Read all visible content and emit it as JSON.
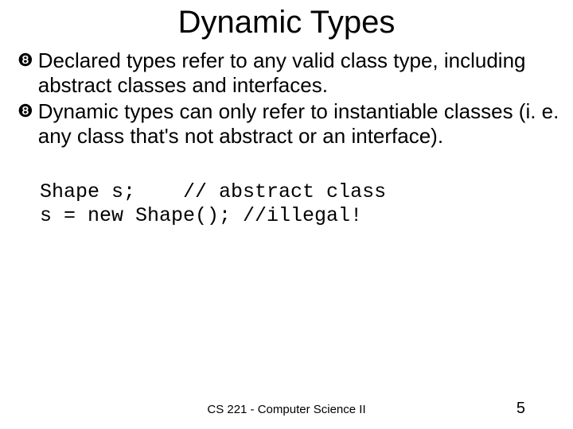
{
  "title": "Dynamic Types",
  "bullets": [
    "Declared types refer to any valid class type, including abstract classes and interfaces.",
    "Dynamic types can only refer to instantiable classes (i. e. any class that's not abstract or an interface)."
  ],
  "code": {
    "line1": "Shape s;    // abstract class",
    "line2": "s = new Shape(); //illegal!"
  },
  "footer": "CS 221 - Computer Science II",
  "page": "5"
}
